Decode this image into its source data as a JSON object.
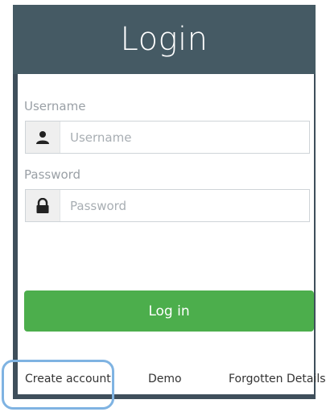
{
  "header": {
    "title": "Login"
  },
  "form": {
    "username_label": "Username",
    "username_placeholder": "Username",
    "password_label": "Password",
    "password_placeholder": "Password",
    "submit_label": "Log in"
  },
  "footer": {
    "create_account": "Create account",
    "demo": "Demo",
    "forgotten_details": "Forgotten Details"
  },
  "icons": {
    "username": "user-icon",
    "password": "lock-icon"
  },
  "colors": {
    "header_bg": "#455a64",
    "button_bg": "#4cae4c",
    "highlight": "#7fb3e2"
  }
}
